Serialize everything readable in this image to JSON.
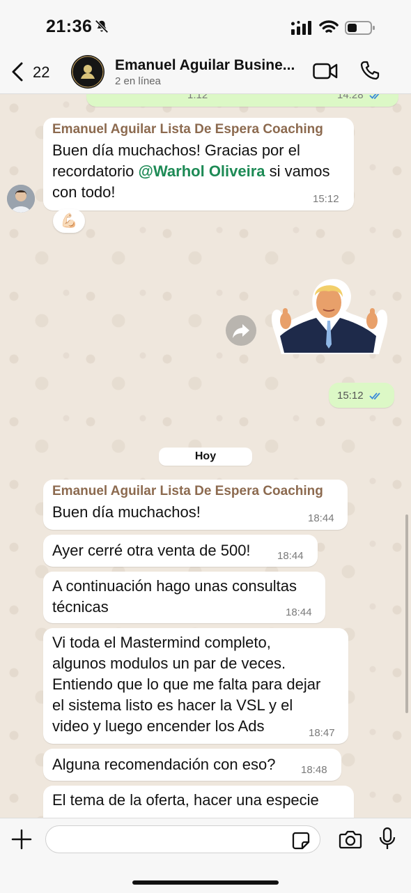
{
  "status": {
    "time": "21:36"
  },
  "header": {
    "back_count": "22",
    "title": "Emanuel Aguilar Busine...",
    "subtitle": "2 en línea"
  },
  "messages": [
    {
      "type": "outgoing-partial",
      "left_time": "1:12",
      "time": "14:28"
    },
    {
      "type": "incoming",
      "sender": "Emanuel Aguilar Lista De Espera Coaching",
      "line1": "Buen día muchachos! Gracias por el",
      "line2_pre": "recordatorio ",
      "mention": "@Warhol Oliveira",
      "line2_post": " si vamos",
      "line3": "con todo!",
      "time": "15:12",
      "reaction": "💪🏻"
    },
    {
      "type": "outgoing-sticker",
      "time": "15:12"
    },
    {
      "type": "day",
      "label": "Hoy"
    },
    {
      "type": "incoming",
      "sender": "Emanuel Aguilar Lista De Espera Coaching",
      "text": "Buen día muchachos!",
      "time": "18:44"
    },
    {
      "type": "incoming",
      "text": "Ayer cerré otra venta de 500!",
      "time": "18:44"
    },
    {
      "type": "incoming",
      "line1": "A continuación hago unas consultas",
      "line2": "técnicas",
      "time": "18:44"
    },
    {
      "type": "incoming",
      "line1": "Vi toda el Mastermind completo,",
      "line2": "algunos modulos un par de veces.",
      "line3": "Entiendo que lo que me falta para dejar",
      "line4": "el sistema listo es hacer la VSL y el",
      "line5": "video y luego encender los Ads",
      "time": "18:47"
    },
    {
      "type": "incoming",
      "text": "Alguna recomendación con eso?",
      "time": "18:48"
    },
    {
      "type": "incoming-partial",
      "line1": "El tema de la oferta, hacer una especie"
    }
  ],
  "composer": {
    "placeholder": ""
  },
  "colors": {
    "outgoing": "#dcf8c6",
    "incoming": "#ffffff",
    "sender": "#8c6a4f",
    "mention": "#1d8a55",
    "read_ticks": "#3b8ad9"
  }
}
